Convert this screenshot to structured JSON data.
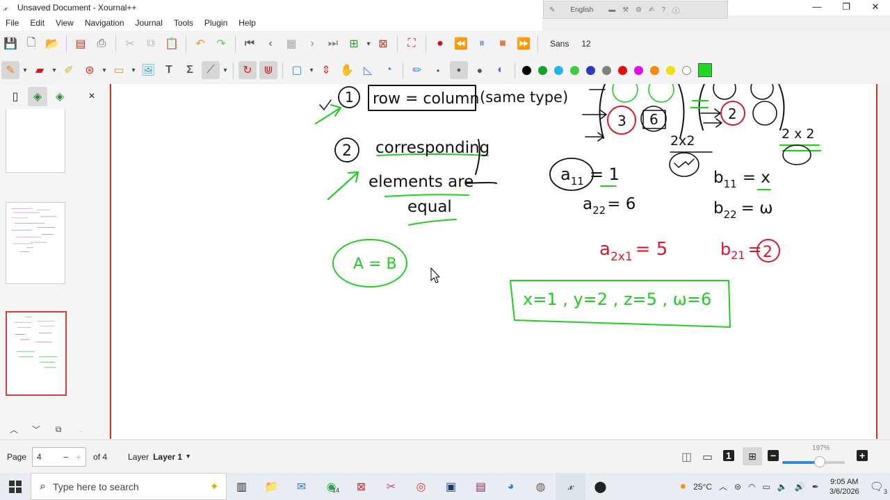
{
  "window": {
    "title": "Unsaved Document - Xournal++",
    "controls": {
      "minimize": "—",
      "maximize": "❐",
      "close": "✕"
    }
  },
  "language_bar": {
    "language": "English"
  },
  "menu": [
    "File",
    "Edit",
    "View",
    "Navigation",
    "Journal",
    "Tools",
    "Plugin",
    "Help"
  ],
  "toolbar1": {
    "font_name": "Sans",
    "font_size": "12"
  },
  "colors": {
    "palette": [
      "#000000",
      "#18a02e",
      "#22b5e8",
      "#3ccc3c",
      "#2a3ab8",
      "#808080",
      "#e01010",
      "#e010e0",
      "#f08a10",
      "#f0e010",
      "#ffffff"
    ],
    "active_color": "#1fd81f",
    "ink_black": "#111111",
    "ink_green": "#22cc22",
    "ink_red": "#d8182a",
    "page_border": "#c0392b"
  },
  "sidebar": {
    "close": "×"
  },
  "canvas": {
    "ink": {
      "t1": "1",
      "t_row_col": "row = column",
      "t_same_type": "(same type)",
      "t2": "2",
      "t_corresponding": "corresponding",
      "t_elements": "elements are",
      "t_equal": "equal",
      "t_ab": "A = B",
      "t_3": "3",
      "t_6": "6",
      "t_2x2a": "2x2",
      "t_2x2b": "2 x 2",
      "t_m2": "2",
      "t_a11": "a",
      "t_a11_sub": "11",
      "t_a11_val": "= 1",
      "t_a22": "a",
      "t_a22_sub": "22",
      "t_a22_val": "= 6",
      "t_b11": "b",
      "t_b11_sub": "11",
      "t_b11_val": "= x",
      "t_b22": "b",
      "t_b22_sub": "22",
      "t_b22_val": "= ω",
      "t_a2x1": "a",
      "t_a2x1_sub": "2x1",
      "t_a2x1_val": "= 5",
      "t_b21": "b",
      "t_b21_sub": "21",
      "t_b21_val": "=",
      "t_b21_circ": "2",
      "t_answer": "x=1 , y=2 , z=5 , ω=6"
    }
  },
  "status": {
    "page_label": "Page",
    "page_value": "4",
    "page_minus": "−",
    "page_plus": "+",
    "page_of": "of 4",
    "layer_label": "Layer",
    "layer_value": "Layer 1",
    "zoom_label": "197%",
    "zoom_fraction": 0.6
  },
  "taskbar": {
    "search_placeholder": "Type here to search",
    "whatsapp_badge": "14",
    "temperature": "25°C",
    "time": "9:05 AM",
    "date": "3/6/2026",
    "notifications": "3"
  }
}
